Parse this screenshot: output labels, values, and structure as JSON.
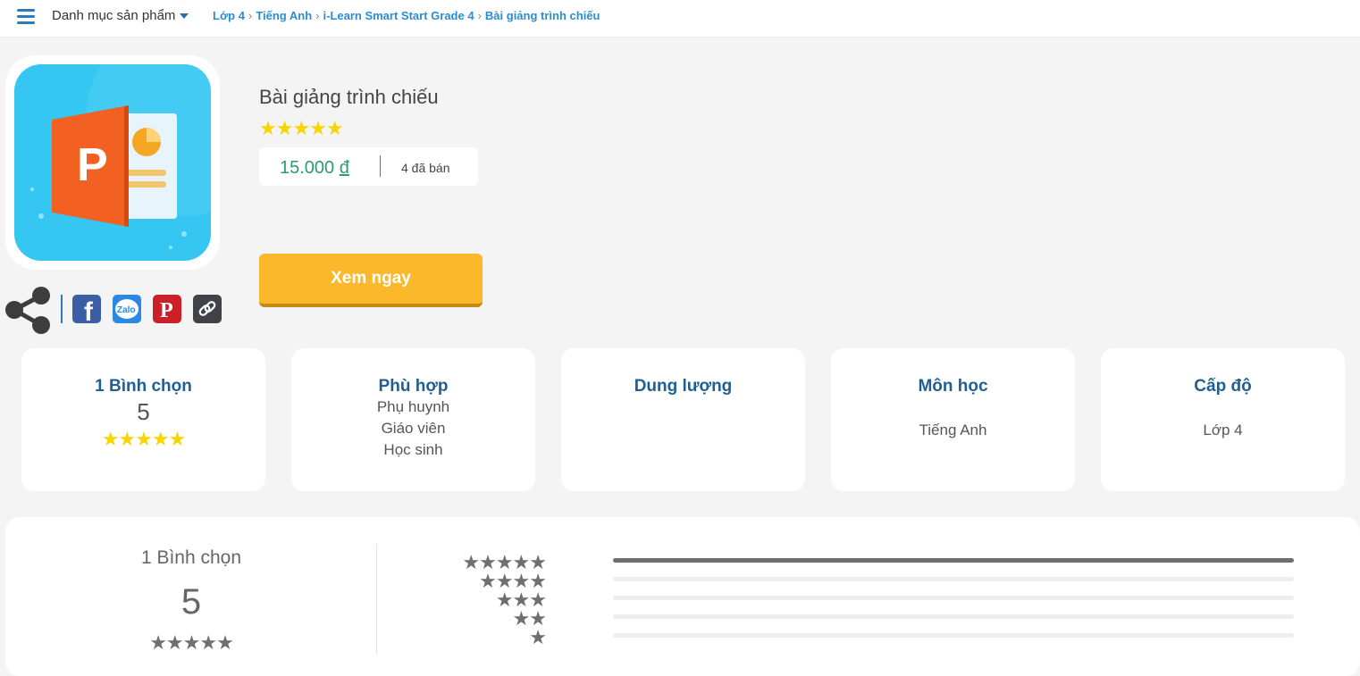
{
  "nav": {
    "menu_icon": "hamburger-icon",
    "category_label": "Danh mục sản phẩm",
    "breadcrumb": [
      "Lớp 4",
      "Tiếng Anh",
      "i-Learn Smart Start Grade 4",
      "Bài giảng trình chiếu"
    ]
  },
  "product": {
    "title": "Bài giảng trình chiếu",
    "stars": "★★★★★",
    "price": "15.000",
    "currency": "đ",
    "sold": "4 đã bán",
    "cta": "Xem ngay",
    "thumbnail_icon": "powerpoint-icon"
  },
  "share": {
    "icons": [
      "share-icon",
      "facebook-icon",
      "zalo-icon",
      "pinterest-icon",
      "link-icon"
    ],
    "zalo_text": "Zalo",
    "pinterest_glyph": "P",
    "facebook_glyph": "f"
  },
  "cards": {
    "votes": {
      "title": "1 Bình chọn",
      "score": "5",
      "stars": "★★★★★"
    },
    "fit": {
      "title": "Phù hợp",
      "items": [
        "Phụ huynh",
        "Giáo viên",
        "Học sinh"
      ]
    },
    "size": {
      "title": "Dung lượng",
      "value": ""
    },
    "subject": {
      "title": "Môn học",
      "value": "Tiếng Anh"
    },
    "level": {
      "title": "Cấp độ",
      "value": "Lớp 4"
    }
  },
  "review": {
    "title": "1 Bình chọn",
    "score": "5",
    "stars": "★★★★★",
    "rows": [
      {
        "stars": "★★★★★",
        "fraction": 1.0
      },
      {
        "stars": "★★★★",
        "fraction": 0
      },
      {
        "stars": "★★★",
        "fraction": 0
      },
      {
        "stars": "★★",
        "fraction": 0
      },
      {
        "stars": "★",
        "fraction": 0
      }
    ]
  },
  "colors": {
    "accent": "#2b7bbb",
    "heading": "#1f5f93",
    "price": "#2a9d6a",
    "button": "#fbb82b",
    "star": "#f7d500"
  }
}
